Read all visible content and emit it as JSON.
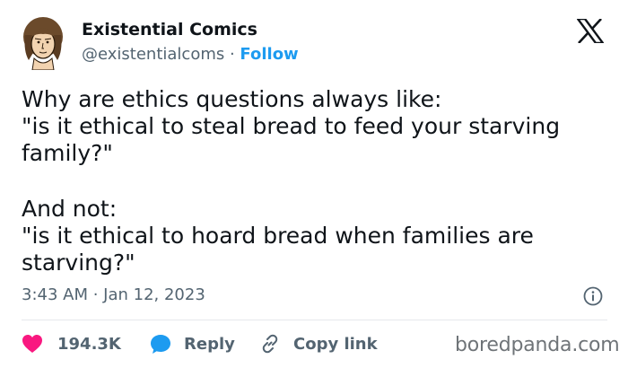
{
  "author": {
    "name": "Existential Comics",
    "handle": "@existentialcoms",
    "separator": " · ",
    "follow_label": "Follow",
    "avatar_icon": "cartoon-portrait-avatar"
  },
  "platform_icon": "x-logo-icon",
  "tweet": {
    "line1": "Why are ethics questions always like:",
    "line2": "\"is it ethical to steal bread to feed your starving family?\"",
    "line3": "And not:",
    "line4": "\"is it ethical to hoard bread when families are starving?\""
  },
  "meta": {
    "timestamp": "3:43 AM · Jan 12, 2023"
  },
  "actions": {
    "likes_count": "194.3K",
    "reply_label": "Reply",
    "copy_link_label": "Copy link"
  },
  "watermark": "boredpanda.com",
  "colors": {
    "like_red": "#f91880",
    "reply_blue": "#1d9bf0",
    "link_blue": "#1d9bf0",
    "text_dark": "#0f1419",
    "text_gray": "#536471"
  }
}
